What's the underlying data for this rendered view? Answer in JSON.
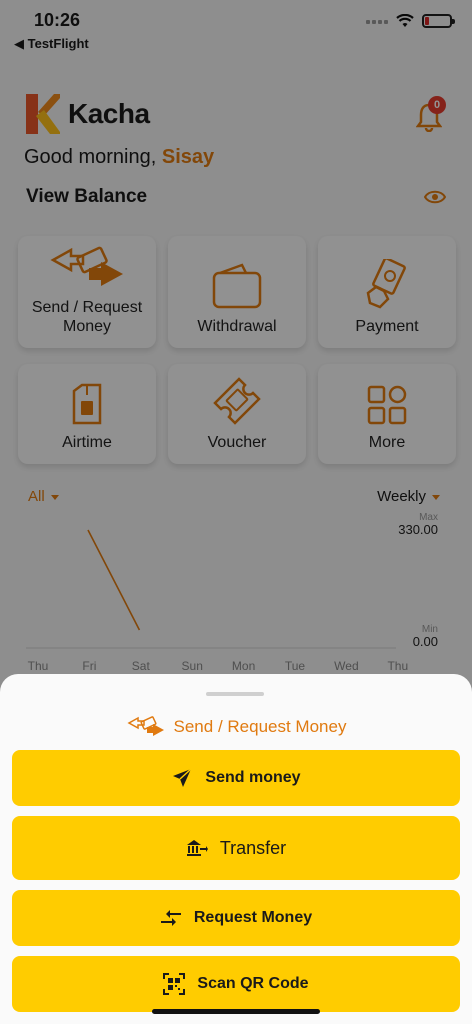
{
  "status": {
    "time": "10:26",
    "back_app": "◀ TestFlight"
  },
  "brand": {
    "name": "Kacha"
  },
  "notifications": {
    "badge": "0"
  },
  "greeting": {
    "prefix": "Good morning, ",
    "name": "Sisay"
  },
  "balance": {
    "label": "View Balance"
  },
  "services": [
    {
      "label": "Send / Request Money",
      "icon": "send-request-icon"
    },
    {
      "label": "Withdrawal",
      "icon": "wallet-icon"
    },
    {
      "label": "Payment",
      "icon": "payment-icon"
    },
    {
      "label": "Airtime",
      "icon": "sim-card-icon"
    },
    {
      "label": "Voucher",
      "icon": "voucher-icon"
    },
    {
      "label": "More",
      "icon": "grid-icon"
    }
  ],
  "chart_filters": {
    "type": "All",
    "period": "Weekly"
  },
  "chart_data": {
    "type": "line",
    "categories": [
      "Thu",
      "Fri",
      "Sat",
      "Sun",
      "Mon",
      "Tue",
      "Wed",
      "Thu"
    ],
    "max_label": "Max",
    "max_value": "330.00",
    "min_label": "Min",
    "min_value": "0.00",
    "series": [
      {
        "values": [
          330,
          0
        ]
      }
    ],
    "ylim": [
      0,
      330
    ]
  },
  "sheet": {
    "title": "Send / Request Money",
    "actions": [
      {
        "label": "Send money",
        "icon": "paper-plane-icon"
      },
      {
        "label": "Transfer",
        "icon": "bank-transfer-icon"
      },
      {
        "label": "Request Money",
        "icon": "arrows-exchange-icon"
      },
      {
        "label": "Scan QR Code",
        "icon": "qr-code-icon"
      }
    ]
  },
  "colors": {
    "accent": "#e07a10",
    "button": "#ffcc00",
    "badge": "#e63b2e"
  }
}
